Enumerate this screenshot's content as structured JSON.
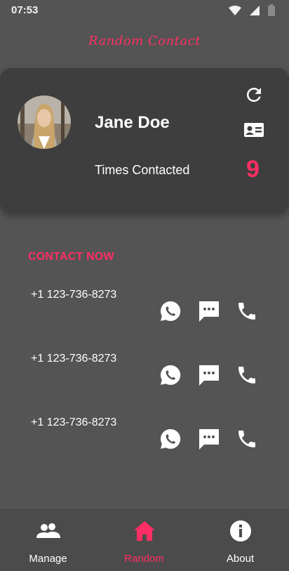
{
  "status_bar": {
    "time": "07:53",
    "icons": [
      "wifi-icon",
      "signal-icon",
      "battery-icon"
    ]
  },
  "app": {
    "title": "Random Contact"
  },
  "card": {
    "name": "Jane Doe",
    "times_label": "Times Contacted",
    "times_count": "9",
    "refresh_icon": "refresh-icon",
    "contact_card_icon": "contact-card-icon"
  },
  "contact_section": {
    "title": "CONTACT NOW",
    "rows": [
      {
        "number": "+1 123-736-8273"
      },
      {
        "number": "+1 123-736-8273"
      },
      {
        "number": "+1 123-736-8273"
      }
    ],
    "action_icons": [
      "whatsapp-icon",
      "sms-icon",
      "phone-icon"
    ]
  },
  "bottom_nav": {
    "items": [
      {
        "label": "Manage",
        "icon": "people-icon",
        "active": false
      },
      {
        "label": "Random",
        "icon": "home-icon",
        "active": true
      },
      {
        "label": "About",
        "icon": "info-icon",
        "active": false
      }
    ]
  },
  "colors": {
    "accent": "#ff2e63",
    "background": "#545454",
    "card": "#3e3e3e",
    "nav": "#4b4b4b"
  }
}
